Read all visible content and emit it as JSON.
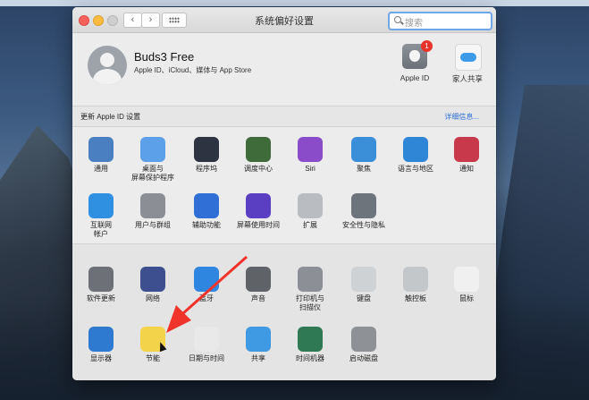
{
  "window": {
    "title": "系统偏好设置"
  },
  "toolbar": {
    "back": "‹",
    "forward": "›"
  },
  "search": {
    "placeholder": "搜索"
  },
  "account": {
    "name": "Buds3 Free",
    "subtitle": "Apple ID、iCloud、媒体与 App Store",
    "apple_id_label": "Apple ID",
    "apple_id_badge": "1",
    "family_label": "家人共享"
  },
  "banner": {
    "text": "更新 Apple ID 设置",
    "link": "详细信息..."
  },
  "panes_row1": [
    {
      "label": "通用",
      "icon": "general-icon",
      "color": "#4a7fc1"
    },
    {
      "label": "桌面与\n屏幕保护程序",
      "icon": "desktop-icon",
      "color": "#5ba0e8"
    },
    {
      "label": "程序坞",
      "icon": "dock-icon",
      "color": "#2d3340"
    },
    {
      "label": "调度中心",
      "icon": "mission-control-icon",
      "color": "#3f6b3b"
    },
    {
      "label": "Siri",
      "icon": "siri-icon",
      "color": "#8a4cc9"
    },
    {
      "label": "聚焦",
      "icon": "spotlight-icon",
      "color": "#3b8fd9"
    },
    {
      "label": "语言与地区",
      "icon": "language-region-icon",
      "color": "#2f86d6"
    },
    {
      "label": "通知",
      "icon": "notifications-icon",
      "color": "#c8394b"
    }
  ],
  "panes_row2": [
    {
      "label": "互联网\n帐户",
      "icon": "internet-accounts-icon",
      "color": "#2f8fe0"
    },
    {
      "label": "用户与群组",
      "icon": "users-groups-icon",
      "color": "#8b8f95"
    },
    {
      "label": "辅助功能",
      "icon": "accessibility-icon",
      "color": "#2f6fd6"
    },
    {
      "label": "屏幕使用时间",
      "icon": "screen-time-icon",
      "color": "#5a3fc2"
    },
    {
      "label": "扩展",
      "icon": "extensions-icon",
      "color": "#b9bdc2"
    },
    {
      "label": "安全性与隐私",
      "icon": "security-privacy-icon",
      "color": "#6e747b"
    }
  ],
  "panes_row3": [
    {
      "label": "软件更新",
      "icon": "software-update-icon",
      "color": "#6d7076"
    },
    {
      "label": "网络",
      "icon": "network-icon",
      "color": "#3d4f8f"
    },
    {
      "label": "蓝牙",
      "icon": "bluetooth-icon",
      "color": "#2f86e0"
    },
    {
      "label": "声音",
      "icon": "sound-icon",
      "color": "#5f6368"
    },
    {
      "label": "打印机与\n扫描仪",
      "icon": "printers-scanners-icon",
      "color": "#8c9096"
    },
    {
      "label": "键盘",
      "icon": "keyboard-icon",
      "color": "#cfd2d5"
    },
    {
      "label": "触控板",
      "icon": "trackpad-icon",
      "color": "#c4c7ca"
    },
    {
      "label": "鼠标",
      "icon": "mouse-icon",
      "color": "#f0f0f0"
    }
  ],
  "panes_row4": [
    {
      "label": "显示器",
      "icon": "displays-icon",
      "color": "#2f7ad1"
    },
    {
      "label": "节能",
      "icon": "energy-saver-icon",
      "color": "#f2d34a"
    },
    {
      "label": "日期与时间",
      "icon": "date-time-icon",
      "color": "#e9e9e9"
    },
    {
      "label": "共享",
      "icon": "sharing-icon",
      "color": "#3f9ae3"
    },
    {
      "label": "时间机器",
      "icon": "time-machine-icon",
      "color": "#2f7a55"
    },
    {
      "label": "启动磁盘",
      "icon": "startup-disk-icon",
      "color": "#8e9297"
    }
  ],
  "annotation": {
    "color": "#f0332a"
  }
}
